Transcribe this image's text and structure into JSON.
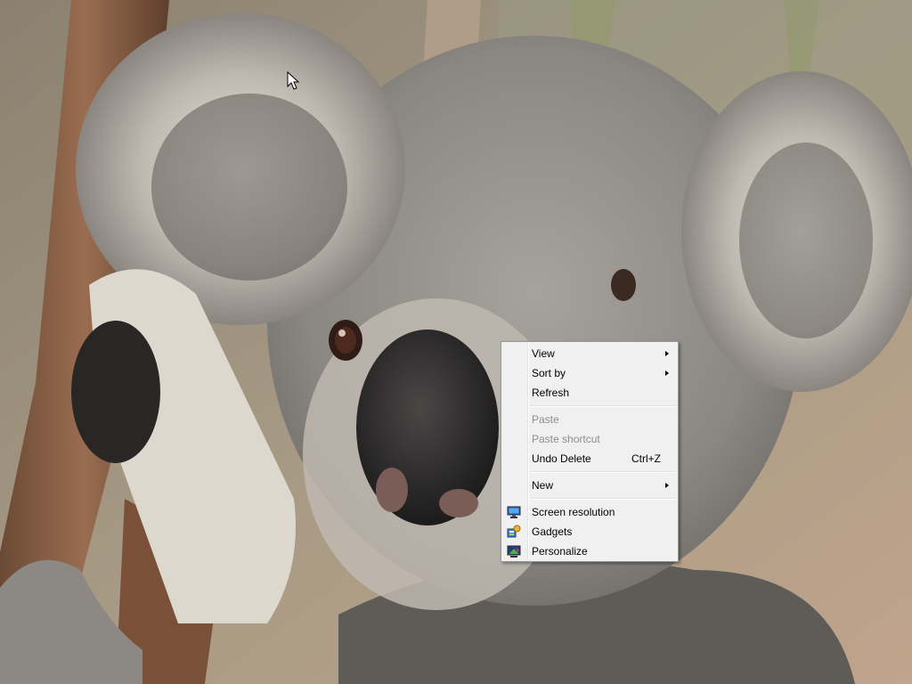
{
  "desktop": {
    "wallpaper": "koala-photo"
  },
  "context_menu": {
    "items": [
      {
        "label": "View",
        "enabled": true,
        "submenu": true
      },
      {
        "label": "Sort by",
        "enabled": true,
        "submenu": true
      },
      {
        "label": "Refresh",
        "enabled": true
      },
      {
        "label": "Paste",
        "enabled": false
      },
      {
        "label": "Paste shortcut",
        "enabled": false
      },
      {
        "label": "Undo Delete",
        "shortcut": "Ctrl+Z",
        "enabled": true
      },
      {
        "label": "New",
        "enabled": true,
        "submenu": true
      },
      {
        "label": "Screen resolution",
        "icon": "screen-resolution-icon",
        "enabled": true
      },
      {
        "label": "Gadgets",
        "icon": "gadgets-icon",
        "enabled": true
      },
      {
        "label": "Personalize",
        "icon": "personalize-icon",
        "enabled": true
      }
    ]
  },
  "colors": {
    "menu_background": "#f0f0f0",
    "menu_border": "#979797",
    "disabled_text": "#8d8d8d"
  }
}
